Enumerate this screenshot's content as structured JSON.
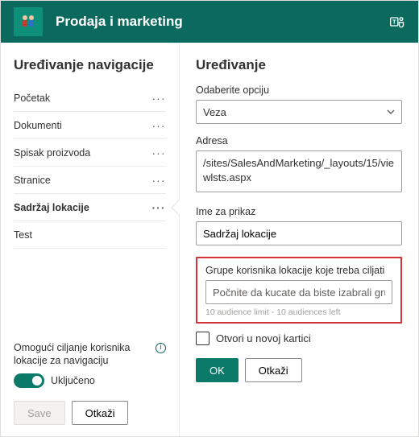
{
  "header": {
    "site_title": "Prodaja i marketing"
  },
  "left_panel": {
    "title": "Uređivanje navigacije",
    "items": [
      {
        "label": "Početak"
      },
      {
        "label": "Dokumenti"
      },
      {
        "label": "Spisak proizvoda"
      },
      {
        "label": "Stranice"
      },
      {
        "label": "Sadržaj lokacije",
        "selected": true
      },
      {
        "label": "Test"
      }
    ],
    "targeting_label": "Omogući ciljanje korisnika lokacije za navigaciju",
    "toggle_label": "Uključeno",
    "save_label": "Save",
    "cancel_label": "Otkaži"
  },
  "right_panel": {
    "title": "Uređivanje",
    "option_label": "Odaberite opciju",
    "option_value": "Veza",
    "address_label": "Adresa",
    "address_value": "/sites/SalesAndMarketing/_layouts/15/viewlsts.aspx",
    "display_label": "Ime za prikaz",
    "display_value": "Sadržaj lokacije",
    "audience_label": "Grupe korisnika lokacije koje treba ciljati",
    "audience_placeholder": "Počnite da kucate da biste izabrali grupe",
    "audience_limit": "10 audience limit - 10 audiences left",
    "newtab_label": "Otvori u novoj kartici",
    "ok_label": "OK",
    "cancel_label": "Otkaži"
  }
}
